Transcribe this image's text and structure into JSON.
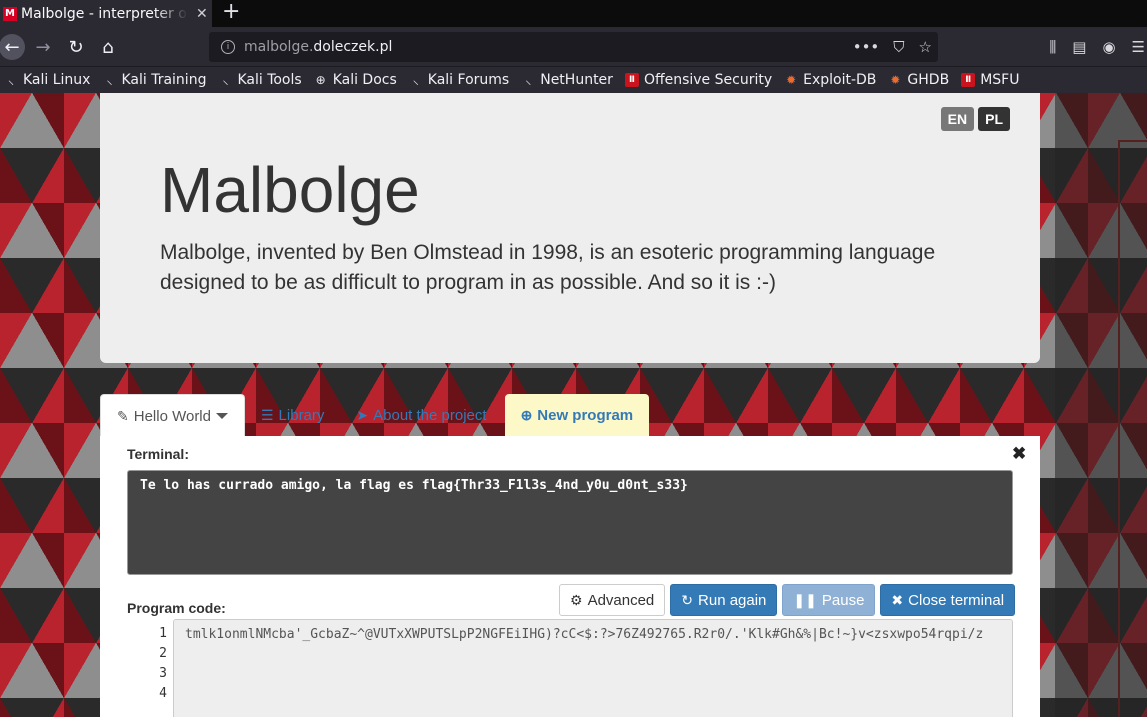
{
  "browser": {
    "tab_title": "Malbolge - interpreter online",
    "tab_favicon": "M",
    "url_prefix": "malbolge.",
    "url_host": "doleczek.pl",
    "bookmarks": [
      {
        "label": "Kali Linux",
        "icon": "kali-icon"
      },
      {
        "label": "Kali Training",
        "icon": "kali-icon"
      },
      {
        "label": "Kali Tools",
        "icon": "kali-icon"
      },
      {
        "label": "Kali Docs",
        "icon": "globe-icon"
      },
      {
        "label": "Kali Forums",
        "icon": "kali-icon"
      },
      {
        "label": "NetHunter",
        "icon": "kali-icon"
      },
      {
        "label": "Offensive Security",
        "icon": "offsec-icon"
      },
      {
        "label": "Exploit-DB",
        "icon": "exploitdb-icon"
      },
      {
        "label": "GHDB",
        "icon": "ghdb-icon"
      },
      {
        "label": "MSFU",
        "icon": "offsec-icon"
      }
    ]
  },
  "site": {
    "lang_en": "EN",
    "lang_pl": "PL",
    "title": "Malbolge",
    "lead": "Malbolge, invented by Ben Olmstead in 1998, is an esoteric programming language designed to be as difficult to program in as possible. And so it is :-)"
  },
  "tabs": {
    "hello": "Hello World",
    "library": "Library",
    "about": "About the project",
    "new_program": "New program"
  },
  "terminal": {
    "label": "Terminal:",
    "output": "Te lo has currado amigo, la flag es flag{Thr33_F1l3s_4nd_y0u_d0nt_s33}"
  },
  "buttons": {
    "advanced": "Advanced",
    "run_again": "Run again",
    "pause": "Pause",
    "close_terminal": "Close terminal"
  },
  "code": {
    "label": "Program code:",
    "line_numbers": [
      "1",
      "2",
      "3",
      "4"
    ],
    "line1": "tmlk1onmlNMcba'_GcbaZ~^@VUTxXWPUTSLpP2NGFEiIHG)?cC<$:?>76Z492765.R2r0/.'Klk#Gh&%|Bc!~}v<zsxwpo54rqpi/z"
  },
  "colors": {
    "accent": "#337ab7",
    "new_program_bg": "#fcf8c8",
    "terminal_bg": "#444444"
  }
}
